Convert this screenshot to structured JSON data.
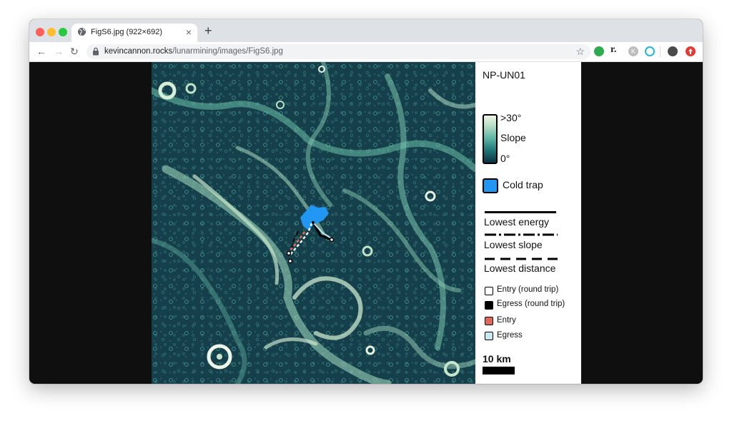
{
  "browser": {
    "tab_title": "FigS6.jpg (922×692)",
    "url_host": "kevincannon.rocks",
    "url_path": "/lunarmining/images/FigS6.jpg",
    "new_tab_label": "+",
    "close_label": "×",
    "back_label": "←",
    "forward_label": "→",
    "reload_label": "↻",
    "star_label": "☆",
    "ext_r_label": "r.",
    "ext_k_label": "K"
  },
  "colors": {
    "traffic_red": "#ff5f57",
    "traffic_yellow": "#febc2e",
    "traffic_green": "#28c840",
    "cold_trap": "#2196f3",
    "entry": "#e0675a",
    "egress": "#c9e9f2"
  },
  "figure": {
    "site": "NP-UN01",
    "slope_max": ">30°",
    "slope_label": "Slope",
    "slope_min": "0°",
    "cold_trap_label": "Cold trap",
    "lowest_energy": "Lowest energy",
    "lowest_slope": "Lowest slope",
    "lowest_distance": "Lowest distance",
    "entry_round_trip": "Entry (round trip)",
    "egress_round_trip": "Egress (round trip)",
    "entry": "Entry",
    "egress": "Egress",
    "scale": "10 km"
  }
}
